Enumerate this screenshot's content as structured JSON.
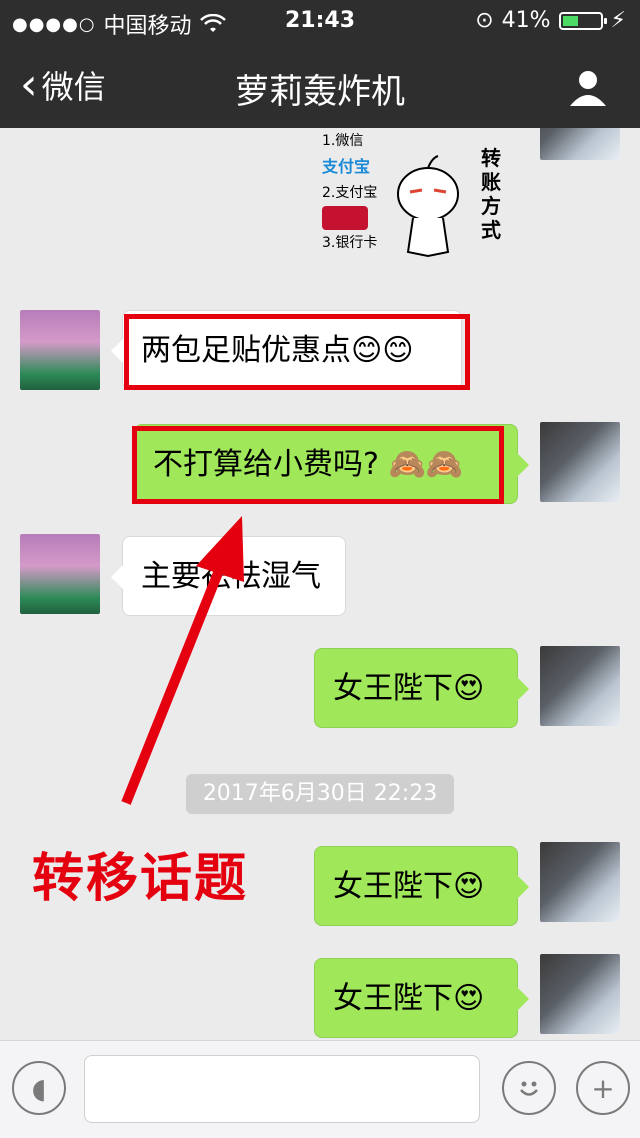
{
  "status": {
    "carrier": "中国移动",
    "time": "21:43",
    "battery": "41%",
    "battery_level": 0.41
  },
  "nav": {
    "back_label": "微信",
    "title": "萝莉轰炸机"
  },
  "sticker": {
    "item1": "1.微信",
    "item2_logo": "支付宝",
    "item2": "2.支付宝",
    "item3": "3.银行卡",
    "vertical_text": "转账方式"
  },
  "messages": [
    {
      "side": "left",
      "text": "两包足贴优惠点😊😊"
    },
    {
      "side": "right",
      "text": "不打算给小费吗? 🙈🙈"
    },
    {
      "side": "left",
      "text": "主要祛祛湿气"
    },
    {
      "side": "right",
      "text": "女王陛下😍"
    },
    {
      "side": "right",
      "text": "女王陛下😍"
    },
    {
      "side": "right",
      "text": "女王陛下😍"
    }
  ],
  "timestamp": "2017年6月30日 22:23",
  "annotation": "转移话题",
  "colors": {
    "highlight": "#e4000f",
    "green_bubble": "#a0e75a",
    "topbar": "#2e2e2e"
  },
  "icons": [
    "voice-icon",
    "emoji-icon",
    "plus-icon",
    "profile-icon",
    "wifi-icon",
    "battery-icon"
  ]
}
